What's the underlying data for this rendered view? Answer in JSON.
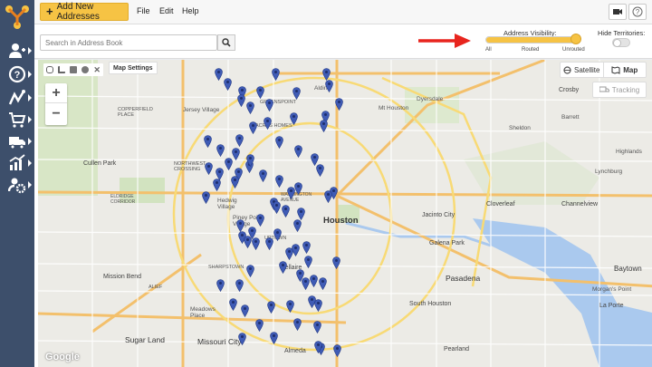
{
  "topbar": {
    "add_button_label": "Add New Addresses",
    "menu": [
      "File",
      "Edit",
      "Help"
    ]
  },
  "search": {
    "placeholder": "Search in Address Book"
  },
  "visibility": {
    "label": "Address Visibility:",
    "ticks": [
      "All",
      "Routed",
      "Unrouted"
    ],
    "selected": "Unrouted",
    "level": 1.0
  },
  "territories": {
    "label": "Hide Territories:",
    "on": false
  },
  "map": {
    "settings_label": "Map Settings",
    "satellite_label": "Satellite",
    "map_label": "Map",
    "tracking_label": "Tracking",
    "google": "Google",
    "labels": {
      "houston": "Houston",
      "aldine": "Aldine",
      "dyersdale": "Dyersdale",
      "mt_houston": "Mt Houston",
      "crosby": "Crosby",
      "barrett": "Barrett",
      "sheldon": "Sheldon",
      "jersey_village": "Jersey Village",
      "copperfield": "COPPERFIELD\nPLACE",
      "northwest": "NORTHWEST\nCROSSING",
      "hedwig": "Hedwig\nVillage",
      "piney_point": "Piney Point\nVillage",
      "cullen_park": "Cullen Park",
      "uptown": "UPTOWN",
      "bellaire": "Bellaire",
      "sharpstown": "SHARPSTOWN",
      "mission_bend": "Mission Bend",
      "meadows_place": "Meadows\nPlace",
      "sugar_land": "Sugar Land",
      "missouri_city": "Missouri City",
      "alief": "ALIEF",
      "jacinto_city": "Jacinto City",
      "galena_park": "Galena Park",
      "pasadena": "Pasadena",
      "south_houston": "South Houston",
      "baytown": "Baytown",
      "morgans_point": "Morgan's Point",
      "la_porte": "La Porte",
      "channelview": "Channelview",
      "cloverleaf": "Cloverleaf",
      "lynchburg": "Lynchburg",
      "highlands": "Highlands",
      "pearland": "Pearland",
      "alameda": "Almeda",
      "greenspoint": "GREENSPOINT",
      "acres_homes": "ACRES HOMES",
      "washington": "WASHINGTON\nAVENUE",
      "eldridge": "ELDRIDGE\nCORRIDOR"
    }
  },
  "colors": {
    "sidebar": "#3d4f6b",
    "accent": "#f6c344",
    "pin": "#3f5bb5",
    "arrow": "#e8251e"
  },
  "icons": [
    "logo-icon",
    "add-user-icon",
    "help-icon",
    "routes-icon",
    "cart-icon",
    "truck-icon",
    "analytics-icon",
    "settings-icon",
    "video-icon",
    "question-icon",
    "search-icon",
    "hand-icon",
    "polygon-icon",
    "square-icon",
    "circle-icon",
    "delete-icon",
    "satellite-icon",
    "map-icon",
    "tracking-icon"
  ]
}
